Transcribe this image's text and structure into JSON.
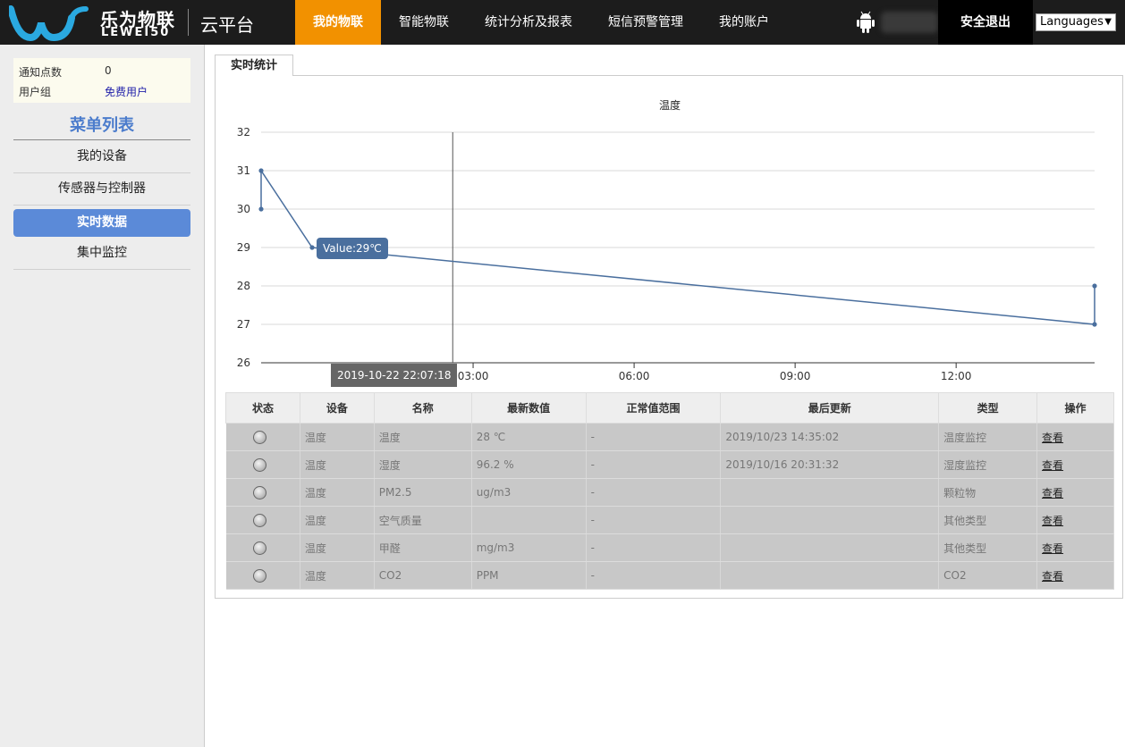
{
  "header": {
    "logo_cn": "乐为物联",
    "logo_en": "LEWEI50",
    "platform": "云平台",
    "nav": [
      {
        "label": "我的物联",
        "active": true
      },
      {
        "label": "智能物联",
        "active": false
      },
      {
        "label": "统计分析及报表",
        "active": false
      },
      {
        "label": "短信预警管理",
        "active": false
      },
      {
        "label": "我的账户",
        "active": false
      }
    ],
    "logout": "安全退出",
    "language": "Languages",
    "brand_color": "#f29100",
    "logo_color": "#2aa9e0"
  },
  "sidebar": {
    "info": [
      {
        "key": "通知点数",
        "value": "0"
      },
      {
        "key": "用户组",
        "value": "免费用户"
      }
    ],
    "menu_title": "菜单列表",
    "items": [
      {
        "label": "我的设备",
        "active": false
      },
      {
        "label": "传感器与控制器",
        "active": false
      },
      {
        "label": "实时数据",
        "active": true
      },
      {
        "label": "集中监控",
        "active": false
      }
    ],
    "accent_color": "#5b8ad8"
  },
  "main": {
    "tab": "实时统计",
    "tooltip": "Value:29℃",
    "crosshair_time": "2019-10-22 22:07:18"
  },
  "chart_data": {
    "type": "line",
    "title": "温度",
    "xlabel": "",
    "ylabel": "",
    "x_tick_labels": [
      "03:00",
      "06:00",
      "09:00",
      "12:00"
    ],
    "x_ticks_hours": [
      3,
      6,
      9,
      12
    ],
    "xlim_hours": [
      -0.95,
      14.58
    ],
    "ylim": [
      26,
      32
    ],
    "y_ticks": [
      26,
      27,
      28,
      29,
      30,
      31,
      32
    ],
    "grid": true,
    "series": [
      {
        "color": "#4a6f9e",
        "x_hours": [
          -0.95,
          -0.95,
          0.0,
          14.58,
          14.58
        ],
        "values": [
          30,
          31,
          29,
          27,
          28
        ]
      }
    ],
    "crosshair_x_hours": 2.62
  },
  "table": {
    "headers": [
      "状态",
      "设备",
      "名称",
      "最新数值",
      "正常值范围",
      "最后更新",
      "类型",
      "操作"
    ],
    "rows": [
      {
        "device": "温度",
        "name": "温度",
        "value": "28 ℃",
        "range": "-",
        "updated": "2019/10/23 14:35:02",
        "type": "温度监控",
        "action": "查看"
      },
      {
        "device": "温度",
        "name": "湿度",
        "value": "96.2 %",
        "range": "-",
        "updated": "2019/10/16 20:31:32",
        "type": "湿度监控",
        "action": "查看"
      },
      {
        "device": "温度",
        "name": "PM2.5",
        "value": "ug/m3",
        "range": "-",
        "updated": "",
        "type": "颗粒物",
        "action": "查看"
      },
      {
        "device": "温度",
        "name": "空气质量",
        "value": "",
        "range": "-",
        "updated": "",
        "type": "其他类型",
        "action": "查看"
      },
      {
        "device": "温度",
        "name": "甲醛",
        "value": "mg/m3",
        "range": "-",
        "updated": "",
        "type": "其他类型",
        "action": "查看"
      },
      {
        "device": "温度",
        "name": "CO2",
        "value": "PPM",
        "range": "-",
        "updated": "",
        "type": "CO2",
        "action": "查看"
      }
    ]
  }
}
